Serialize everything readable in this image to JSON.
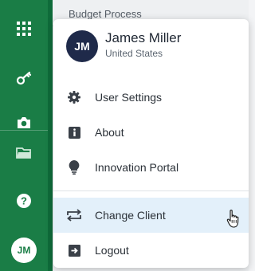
{
  "sidebar": {
    "items": [
      {
        "icon": "apps-grid-icon"
      },
      {
        "icon": "key-icon"
      },
      {
        "icon": "camera-icon"
      },
      {
        "icon": "folder-icon"
      },
      {
        "icon": "help-icon"
      }
    ],
    "avatar_initials": "JM",
    "background_color": "#1a7d46"
  },
  "background": {
    "page_title": "Budget Process"
  },
  "menu": {
    "profile": {
      "initials": "JM",
      "name": "James Miller",
      "country": "United States",
      "avatar_color": "#1f2a4a"
    },
    "items": [
      {
        "label": "User Settings",
        "icon": "gear-icon"
      },
      {
        "label": "About",
        "icon": "info-icon"
      },
      {
        "label": "Innovation Portal",
        "icon": "lightbulb-icon"
      },
      {
        "label": "Change Client",
        "icon": "swap-arrows-icon",
        "highlighted": true
      },
      {
        "label": "Logout",
        "icon": "logout-icon"
      }
    ],
    "highlight_color": "#e3f0fa"
  }
}
